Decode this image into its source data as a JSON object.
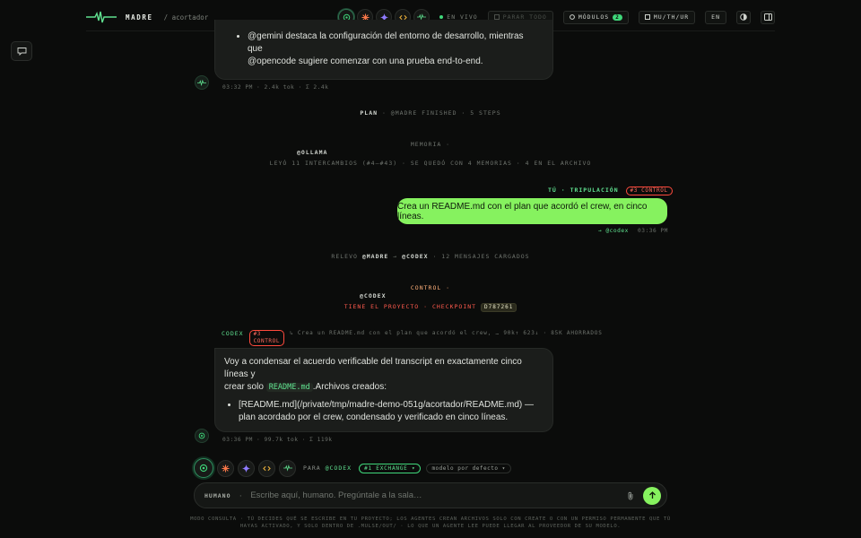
{
  "topbar": {
    "brand": "MADRE",
    "crumb": "/ acortador",
    "agents": [
      "codex",
      "claude",
      "gemini",
      "opencode",
      "madre"
    ],
    "live_label": "EN VIVO",
    "stop_label": "PARAR TODO",
    "modules_label": "MÓDULOS",
    "modules_count": "2",
    "shortcut_label": "MU/TH/UR",
    "lang_label": "EN"
  },
  "messages": {
    "m1_text_line1": "@gemini destaca la configuración del entorno de desarrollo, mientras que",
    "m1_text_line2": "@opencode sugiere comenzar con una prueba end-to-end.",
    "m1_meta": "03:32 PM · 2.4k tok · Σ 2.4k",
    "plan_label": "PLAN",
    "plan_rest": "· @MADRE FINISHED · 5 STEPS",
    "memoria_title": "MEMORIA ·",
    "memoria_agent": "@OLLAMA",
    "memoria_line": "LEYÓ 11 INTERCAMBIOS (#4–#43) · SE QUEDÓ CON 4 MEMORIAS · 4 EN EL ARCHIVO",
    "user_header": "TÚ · TRIPULACIÓN",
    "user_ctrl": "#3 CONTROL",
    "user_text": "Crea un README.md con el plan que acordó el crew, en cinco líneas.",
    "user_meta_target": "→ @codex",
    "user_meta_time": "03:36 PM",
    "relevo_pre": "RELEVO",
    "relevo_from": "@MADRE",
    "relevo_arrow": "→",
    "relevo_to": "@CODEX",
    "relevo_post": "· 12 MENSAJES CARGADOS",
    "control_title": "CONTROL ·",
    "control_agent": "@CODEX",
    "control_line": "TIENE EL PROYECTO · CHECKPOINT",
    "control_hash": "D787261",
    "codex_name": "CODEX",
    "codex_ctrl": "#3 CONTROL",
    "codex_context": "↳ Crea un README.md con el plan que acordó el crew, …  90k↑ 623↓ · 85K AHORRADOS",
    "m2_line1": "Voy a condensar el acuerdo verificable del transcript en exactamente cinco líneas y",
    "m2_line2_pre": "crear solo",
    "m2_code": "README.md",
    "m2_line2_post": ".Archivos creados:",
    "m2_bullet": "[README.md](/private/tmp/madre-demo-051g/acortador/README.md) — plan acordado por el crew, condensado y verificado en cinco líneas.",
    "m2_meta": "03:36 PM · 99.7k tok · Σ 119k"
  },
  "composer": {
    "para_label": "PARA",
    "para_target": "@CODEX",
    "exchange_label": "#1 EXCHANGE ▾",
    "model_label": "modelo por defecto ▾",
    "who_label": "HUMANO",
    "who_sep": "·",
    "placeholder": "Escribe aquí, humano. Pregúntale a la sala…"
  },
  "footer": "MODO CONSULTA · TÚ DECIDES QUÉ SE ESCRIBE EN TU PROYECTO; LOS AGENTES CREAN ARCHIVOS SOLO CON CREATE O CON UN PERMISO PERMANENTE QUE TÚ HAYAS ACTIVADO, Y SOLO DENTRO DE .MULSE/OUT/ · LO QUE UN AGENTE LEE PUEDE LLEGAR AL PROVEEDOR DE SU MODELO.",
  "colors": {
    "accent": "#86f25f",
    "live": "#3fd77a",
    "control": "#ff4a3d",
    "background": "#0b0c0b"
  }
}
